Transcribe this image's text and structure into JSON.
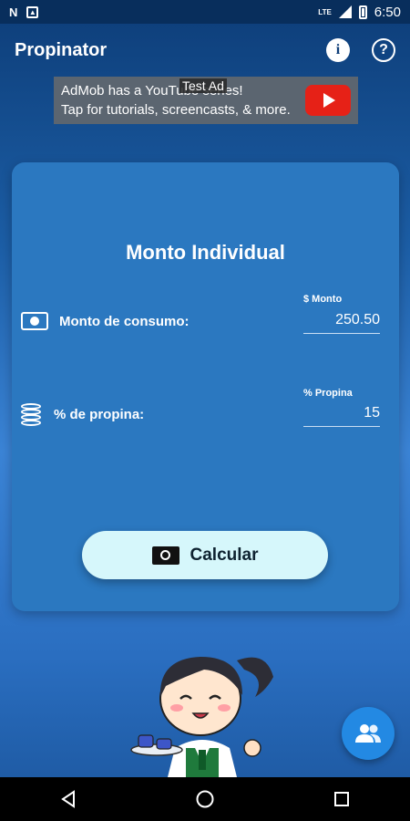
{
  "status_bar": {
    "left_icons": [
      "notification-n-icon",
      "photo-icon"
    ],
    "time": "6:50",
    "lte": "LTE"
  },
  "app_bar": {
    "title": "Propinator",
    "info_icon": "info-icon",
    "help_icon": "help-icon"
  },
  "ad": {
    "line1": "AdMob has a YouTube series!",
    "line2": "Tap for tutorials, screencasts, & more.",
    "tag": "Test Ad"
  },
  "card": {
    "title": "Monto Individual",
    "amount_label": "Monto de consumo:",
    "amount_caption": "$ Monto",
    "amount_value": "250.50",
    "tip_label": "% de propina:",
    "tip_caption": "% Propina",
    "tip_value": "15",
    "calc_button": "Calcular"
  },
  "fab": {
    "icon": "group-icon"
  },
  "nav_bar": {
    "back": "back-icon",
    "home": "home-icon",
    "recents": "recents-icon"
  },
  "colors": {
    "primary": "#2b78c0",
    "button": "#d6f7fb",
    "fab": "#2389e3"
  }
}
